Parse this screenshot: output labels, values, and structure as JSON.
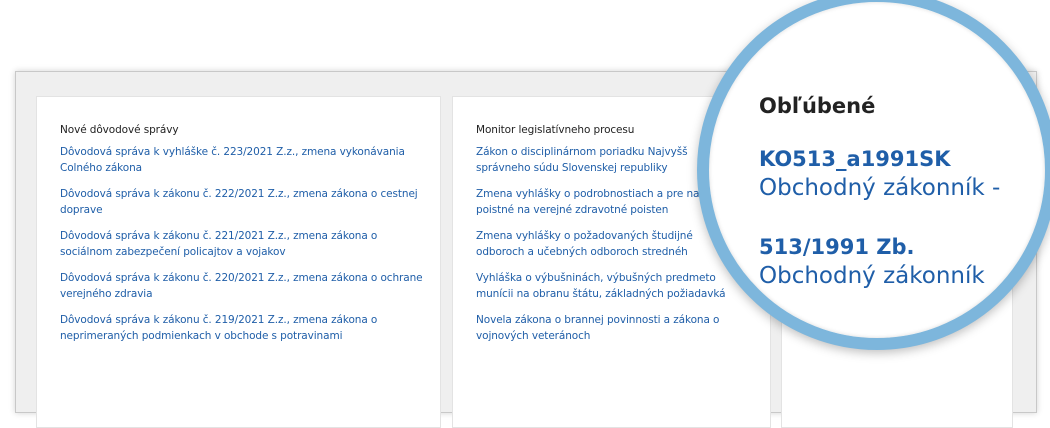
{
  "cards": [
    {
      "heading": "Nové dôvodové správy",
      "items": [
        "Dôvodová správa k vyhláške č. 223/2021 Z.z., zmena vykonávania Colného zákona",
        "Dôvodová správa k zákonu č. 222/2021 Z.z., zmena zákona o cestnej doprave",
        "Dôvodová správa k zákonu č. 221/2021 Z.z., zmena zákona o sociálnom zabezpečení policajtov a vojakov",
        "Dôvodová správa k zákonu č. 220/2021 Z.z., zmena zákona o ochrane verejného zdravia",
        "Dôvodová správa k zákonu č. 219/2021 Z.z., zmena zákona o neprimeraných podmienkach v obchode s potravinami"
      ]
    },
    {
      "heading": "Monitor legislatívneho procesu",
      "items": [
        "Zákon o disciplinárnom poriadku Najvyšš správneho súdu Slovenskej republiky",
        "Zmena vyhlášky o podrobnostiach a pre na poistné na verejné zdravotné poisten",
        "Zmena vyhlášky o požadovaných študijné odboroch a učebných odboroch strednéh",
        "Vyhláška o výbušninách, výbušných predmeto munícii na obranu štátu, základných požiadavká",
        "Novela zákona o brannej povinnosti a zákona o vojnových veteránoch"
      ]
    }
  ],
  "favorites": {
    "title": "Obľúbené",
    "items": [
      {
        "code": "KO513_a1991SK",
        "name": "Obchodný zákonník -"
      },
      {
        "code": "513/1991 Zb.",
        "name": "Obchodný zákonník"
      }
    ]
  },
  "colors": {
    "link": "#1f5ea8",
    "magnifier_ring": "#7db6dc"
  }
}
